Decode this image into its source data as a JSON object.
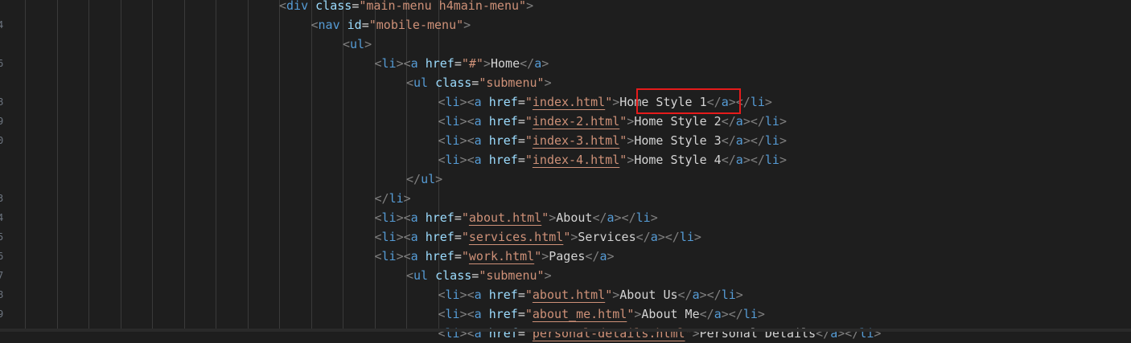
{
  "editor": {
    "gutter_fragments": [
      "",
      "4",
      "",
      "6",
      "",
      "8",
      "9",
      "0",
      "",
      "",
      "3",
      "4",
      "5",
      "6",
      "7",
      "8",
      "9"
    ],
    "lines": [
      {
        "indent": 8,
        "tokens": [
          [
            "t",
            "<"
          ],
          [
            "tn",
            "div"
          ],
          [
            "at",
            " class"
          ],
          [
            "eq",
            "="
          ],
          [
            "st",
            "\"main-menu h4main-menu\""
          ],
          [
            "t",
            ">"
          ]
        ]
      },
      {
        "indent": 9,
        "tokens": [
          [
            "t",
            "<"
          ],
          [
            "tn",
            "nav"
          ],
          [
            "at",
            " id"
          ],
          [
            "eq",
            "="
          ],
          [
            "st",
            "\"mobile-menu\""
          ],
          [
            "t",
            ">"
          ]
        ]
      },
      {
        "indent": 10,
        "tokens": [
          [
            "t",
            "<"
          ],
          [
            "tn",
            "ul"
          ],
          [
            "t",
            ">"
          ]
        ]
      },
      {
        "indent": 11,
        "tokens": [
          [
            "t",
            "<"
          ],
          [
            "tn",
            "li"
          ],
          [
            "t",
            "><"
          ],
          [
            "tn",
            "a"
          ],
          [
            "at",
            " href"
          ],
          [
            "eq",
            "="
          ],
          [
            "st",
            "\"#\""
          ],
          [
            "t",
            ">"
          ],
          [
            "tx",
            "Home"
          ],
          [
            "t",
            "</"
          ],
          [
            "tn",
            "a"
          ],
          [
            "t",
            ">"
          ]
        ]
      },
      {
        "indent": 12,
        "tokens": [
          [
            "t",
            "<"
          ],
          [
            "tn",
            "ul"
          ],
          [
            "at",
            " class"
          ],
          [
            "eq",
            "="
          ],
          [
            "st",
            "\"submenu\""
          ],
          [
            "t",
            ">"
          ]
        ]
      },
      {
        "indent": 13,
        "tokens": [
          [
            "t",
            "<"
          ],
          [
            "tn",
            "li"
          ],
          [
            "t",
            "><"
          ],
          [
            "tn",
            "a"
          ],
          [
            "at",
            " href"
          ],
          [
            "eq",
            "="
          ],
          [
            "st",
            "\""
          ],
          [
            "su",
            "index.html"
          ],
          [
            "st",
            "\""
          ],
          [
            "t",
            ">"
          ],
          [
            "tx",
            "Home Style 1"
          ],
          [
            "t",
            "</"
          ],
          [
            "tn",
            "a"
          ],
          [
            "t",
            "></"
          ],
          [
            "tn",
            "li"
          ],
          [
            "t",
            ">"
          ]
        ]
      },
      {
        "indent": 13,
        "tokens": [
          [
            "t",
            "<"
          ],
          [
            "tn",
            "li"
          ],
          [
            "t",
            "><"
          ],
          [
            "tn",
            "a"
          ],
          [
            "at",
            " href"
          ],
          [
            "eq",
            "="
          ],
          [
            "st",
            "\""
          ],
          [
            "su",
            "index-2.html"
          ],
          [
            "st",
            "\""
          ],
          [
            "t",
            ">"
          ],
          [
            "tx",
            "Home Style 2"
          ],
          [
            "t",
            "</"
          ],
          [
            "tn",
            "a"
          ],
          [
            "t",
            "></"
          ],
          [
            "tn",
            "li"
          ],
          [
            "t",
            ">"
          ]
        ]
      },
      {
        "indent": 13,
        "tokens": [
          [
            "t",
            "<"
          ],
          [
            "tn",
            "li"
          ],
          [
            "t",
            "><"
          ],
          [
            "tn",
            "a"
          ],
          [
            "at",
            " href"
          ],
          [
            "eq",
            "="
          ],
          [
            "st",
            "\""
          ],
          [
            "su",
            "index-3.html"
          ],
          [
            "st",
            "\""
          ],
          [
            "t",
            ">"
          ],
          [
            "tx",
            "Home Style 3"
          ],
          [
            "t",
            "</"
          ],
          [
            "tn",
            "a"
          ],
          [
            "t",
            "></"
          ],
          [
            "tn",
            "li"
          ],
          [
            "t",
            ">"
          ]
        ]
      },
      {
        "indent": 13,
        "tokens": [
          [
            "t",
            "<"
          ],
          [
            "tn",
            "li"
          ],
          [
            "t",
            "><"
          ],
          [
            "tn",
            "a"
          ],
          [
            "at",
            " href"
          ],
          [
            "eq",
            "="
          ],
          [
            "st",
            "\""
          ],
          [
            "su",
            "index-4.html"
          ],
          [
            "st",
            "\""
          ],
          [
            "t",
            ">"
          ],
          [
            "tx",
            "Home Style 4"
          ],
          [
            "t",
            "</"
          ],
          [
            "tn",
            "a"
          ],
          [
            "t",
            "></"
          ],
          [
            "tn",
            "li"
          ],
          [
            "t",
            ">"
          ]
        ]
      },
      {
        "indent": 12,
        "tokens": [
          [
            "t",
            "</"
          ],
          [
            "tn",
            "ul"
          ],
          [
            "t",
            ">"
          ]
        ]
      },
      {
        "indent": 11,
        "tokens": [
          [
            "t",
            "</"
          ],
          [
            "tn",
            "li"
          ],
          [
            "t",
            ">"
          ]
        ]
      },
      {
        "indent": 11,
        "tokens": [
          [
            "t",
            "<"
          ],
          [
            "tn",
            "li"
          ],
          [
            "t",
            "><"
          ],
          [
            "tn",
            "a"
          ],
          [
            "at",
            " href"
          ],
          [
            "eq",
            "="
          ],
          [
            "st",
            "\""
          ],
          [
            "su",
            "about.html"
          ],
          [
            "st",
            "\""
          ],
          [
            "t",
            ">"
          ],
          [
            "tx",
            "About"
          ],
          [
            "t",
            "</"
          ],
          [
            "tn",
            "a"
          ],
          [
            "t",
            "></"
          ],
          [
            "tn",
            "li"
          ],
          [
            "t",
            ">"
          ]
        ]
      },
      {
        "indent": 11,
        "tokens": [
          [
            "t",
            "<"
          ],
          [
            "tn",
            "li"
          ],
          [
            "t",
            "><"
          ],
          [
            "tn",
            "a"
          ],
          [
            "at",
            " href"
          ],
          [
            "eq",
            "="
          ],
          [
            "st",
            "\""
          ],
          [
            "su",
            "services.html"
          ],
          [
            "st",
            "\""
          ],
          [
            "t",
            ">"
          ],
          [
            "tx",
            "Services"
          ],
          [
            "t",
            "</"
          ],
          [
            "tn",
            "a"
          ],
          [
            "t",
            "></"
          ],
          [
            "tn",
            "li"
          ],
          [
            "t",
            ">"
          ]
        ]
      },
      {
        "indent": 11,
        "tokens": [
          [
            "t",
            "<"
          ],
          [
            "tn",
            "li"
          ],
          [
            "t",
            "><"
          ],
          [
            "tn",
            "a"
          ],
          [
            "at",
            " href"
          ],
          [
            "eq",
            "="
          ],
          [
            "st",
            "\""
          ],
          [
            "su",
            "work.html"
          ],
          [
            "st",
            "\""
          ],
          [
            "t",
            ">"
          ],
          [
            "tx",
            "Pages"
          ],
          [
            "t",
            "</"
          ],
          [
            "tn",
            "a"
          ],
          [
            "t",
            ">"
          ]
        ]
      },
      {
        "indent": 12,
        "tokens": [
          [
            "t",
            "<"
          ],
          [
            "tn",
            "ul"
          ],
          [
            "at",
            " class"
          ],
          [
            "eq",
            "="
          ],
          [
            "st",
            "\"submenu\""
          ],
          [
            "t",
            ">"
          ]
        ]
      },
      {
        "indent": 13,
        "tokens": [
          [
            "t",
            "<"
          ],
          [
            "tn",
            "li"
          ],
          [
            "t",
            "><"
          ],
          [
            "tn",
            "a"
          ],
          [
            "at",
            " href"
          ],
          [
            "eq",
            "="
          ],
          [
            "st",
            "\""
          ],
          [
            "su",
            "about.html"
          ],
          [
            "st",
            "\""
          ],
          [
            "t",
            ">"
          ],
          [
            "tx",
            "About Us"
          ],
          [
            "t",
            "</"
          ],
          [
            "tn",
            "a"
          ],
          [
            "t",
            "></"
          ],
          [
            "tn",
            "li"
          ],
          [
            "t",
            ">"
          ]
        ]
      },
      {
        "indent": 13,
        "tokens": [
          [
            "t",
            "<"
          ],
          [
            "tn",
            "li"
          ],
          [
            "t",
            "><"
          ],
          [
            "tn",
            "a"
          ],
          [
            "at",
            " href"
          ],
          [
            "eq",
            "="
          ],
          [
            "st",
            "\""
          ],
          [
            "su",
            "about_me.html"
          ],
          [
            "st",
            "\""
          ],
          [
            "t",
            ">"
          ],
          [
            "tx",
            "About Me"
          ],
          [
            "t",
            "</"
          ],
          [
            "tn",
            "a"
          ],
          [
            "t",
            "></"
          ],
          [
            "tn",
            "li"
          ],
          [
            "t",
            ">"
          ]
        ]
      },
      {
        "indent": 13,
        "tokens": [
          [
            "t",
            "<"
          ],
          [
            "tn",
            "li"
          ],
          [
            "t",
            "><"
          ],
          [
            "tn",
            "a"
          ],
          [
            "at",
            " href"
          ],
          [
            "eq",
            "="
          ],
          [
            "st",
            "\""
          ],
          [
            "su",
            "personal-details.html"
          ],
          [
            "st",
            "\""
          ],
          [
            "t",
            ">"
          ],
          [
            "tx",
            "Personal Details"
          ],
          [
            "t",
            "</"
          ],
          [
            "tn",
            "a"
          ],
          [
            "t",
            "></"
          ],
          [
            "tn",
            "li"
          ],
          [
            "t",
            ">"
          ]
        ]
      }
    ],
    "highlight_color": "#e51b1b"
  }
}
